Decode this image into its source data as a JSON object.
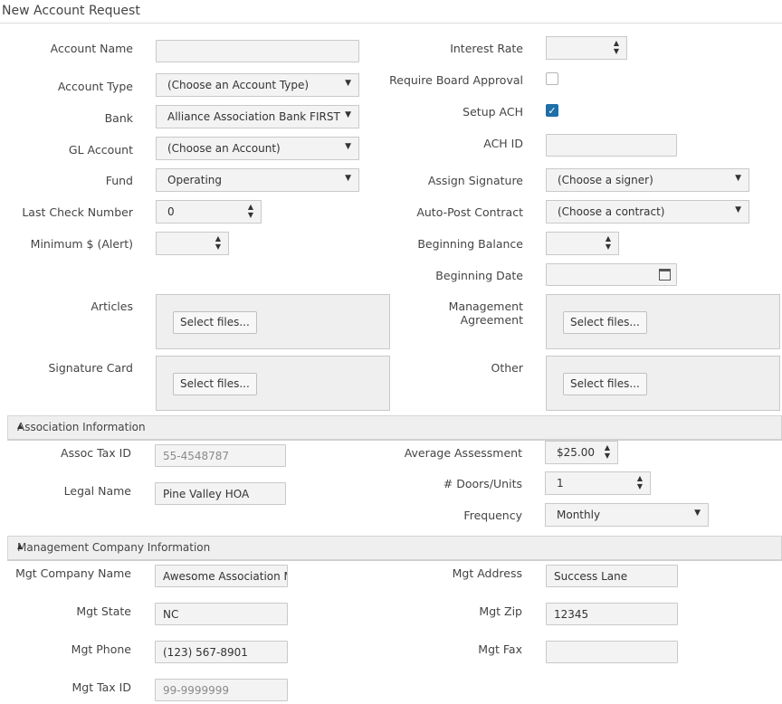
{
  "title": "New Account Request",
  "left": {
    "account_name": {
      "label": "Account Name",
      "value": ""
    },
    "account_type": {
      "label": "Account Type",
      "value": "(Choose an Account Type)"
    },
    "bank": {
      "label": "Bank",
      "value": "Alliance Association Bank FIRST"
    },
    "gl_account": {
      "label": "GL Account",
      "value": "(Choose an Account)"
    },
    "fund": {
      "label": "Fund",
      "value": "Operating"
    },
    "last_check": {
      "label": "Last Check Number",
      "value": "0"
    },
    "minimum_alert": {
      "label": "Minimum $ (Alert)",
      "value": ""
    },
    "articles": {
      "label": "Articles",
      "button": "Select files..."
    },
    "signature_card": {
      "label": "Signature Card",
      "button": "Select files..."
    }
  },
  "right": {
    "interest_rate": {
      "label": "Interest Rate",
      "value": ""
    },
    "require_board": {
      "label": "Require Board Approval",
      "checked": false
    },
    "setup_ach": {
      "label": "Setup ACH",
      "checked": true
    },
    "ach_id": {
      "label": "ACH ID",
      "value": ""
    },
    "assign_signature": {
      "label": "Assign Signature",
      "value": "(Choose a signer)"
    },
    "auto_post": {
      "label": "Auto-Post Contract",
      "value": "(Choose a contract)"
    },
    "beginning_balance": {
      "label": "Beginning Balance",
      "value": ""
    },
    "beginning_date": {
      "label": "Beginning Date",
      "value": ""
    },
    "management_agreement": {
      "label_line1": "Management",
      "label_line2": "Agreement",
      "button": "Select files..."
    },
    "other": {
      "label": "Other",
      "button": "Select files..."
    }
  },
  "association": {
    "header": "Association Information",
    "assoc_tax_id": {
      "label": "Assoc Tax ID",
      "value": "55-4548787"
    },
    "legal_name": {
      "label": "Legal Name",
      "value": "Pine Valley HOA"
    },
    "average_assessment": {
      "label": "Average Assessment",
      "value": "$25.00"
    },
    "doors_units": {
      "label": "# Doors/Units",
      "value": "1"
    },
    "frequency": {
      "label": "Frequency",
      "value": "Monthly"
    }
  },
  "mgmt": {
    "header": "Management Company Information",
    "company_name": {
      "label": "Mgt Company Name",
      "value": "Awesome Association M"
    },
    "state": {
      "label": "Mgt State",
      "value": "NC"
    },
    "phone": {
      "label": "Mgt Phone",
      "value": "(123) 567-8901"
    },
    "tax_id": {
      "label": "Mgt Tax ID",
      "value": "99-9999999"
    },
    "address": {
      "label": "Mgt Address",
      "value": "Success Lane"
    },
    "zip": {
      "label": "Mgt Zip",
      "value": "12345"
    },
    "fax": {
      "label": "Mgt Fax",
      "value": ""
    }
  },
  "icons": {
    "select_caret": "▼",
    "spin_up": "▲",
    "spin_down": "▼",
    "check": "✓",
    "collapse": "▲"
  }
}
